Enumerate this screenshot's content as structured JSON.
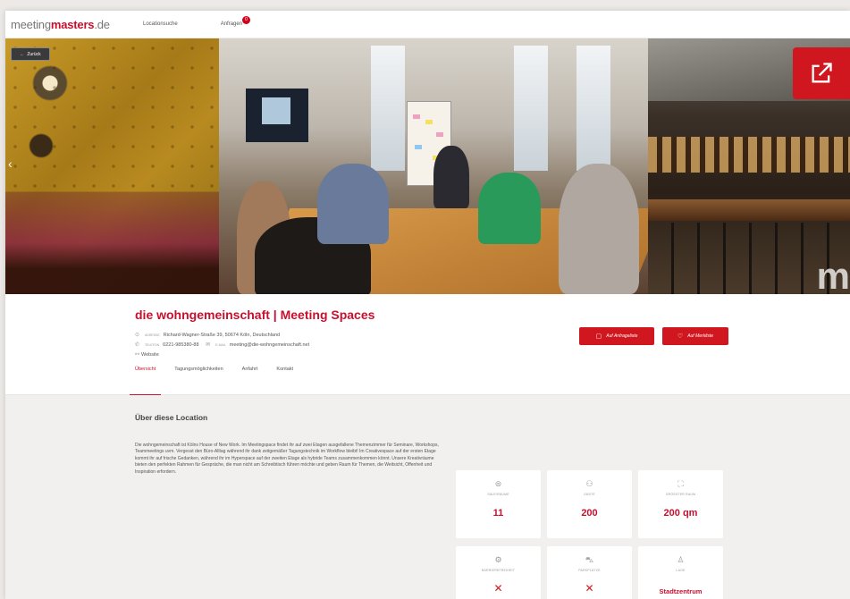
{
  "nav": {
    "logo_prefix": "meeting",
    "logo_brand": "masters",
    "logo_tld": ".de",
    "links": [
      "Locationsuche",
      "Anfragen"
    ],
    "requests_count": "0"
  },
  "hero": {
    "back_label": "Zurück",
    "watermark": "m"
  },
  "venue": {
    "title": "die wohngemeinschaft | Meeting Spaces",
    "address_label": "Adresse",
    "address": "Richard-Wagner-Straße 39, 50674 Köln, Deutschland",
    "phone_label": "Telefon",
    "phone": "0221-985380-88",
    "email_label": "E-Mail",
    "email": "meeting@die-wohngemeinschaft.net",
    "website": "Website",
    "btn_request": "Auf Anfrageliste",
    "btn_watch": "Auf Merkliste"
  },
  "tabs": [
    "Übersicht",
    "Tagungsmöglichkeiten",
    "Anfahrt",
    "Kontakt"
  ],
  "about": {
    "heading": "Über diese Location",
    "text": "Die wohngemeinschaft ist Kölns House of New Work. Im Meetingspace findet ihr auf zwei Etagen ausgefallene Themenzimmer für Seminare, Workshops, Teammeetings uvm. Vergesst den Büro-Alltag während ihr dank zeitgemäßer Tagungstechnik im Workflow bleibt! Im Creativespace auf der ersten Etage kommt ihr auf frische Gedanken, während ihr im Hyperspace auf der zweiten Etage als hybride Teams zusammenkommen könnt. Unsere Kreativräume bieten den perfekten Rahmen für Gespräche, die man nicht am Schreibtisch führen möchte und geben Raum für Themen, die Weitsicht, Offenheit und Inspiration erfordern."
  },
  "facts": [
    {
      "label": "Säle/Räume",
      "value": "11",
      "icon": "rooms-icon",
      "glyph": "⊜"
    },
    {
      "label": "Gäste",
      "value": "200",
      "icon": "guests-icon",
      "glyph": "⚇"
    },
    {
      "label": "Größter Raum",
      "value": "200 qm",
      "icon": "area-icon",
      "glyph": "⛶"
    },
    {
      "label": "Barrierefreiheit",
      "value": "✕",
      "icon": "accessibility-icon",
      "glyph": "⚙"
    },
    {
      "label": "Parkplätze",
      "value": "✕",
      "icon": "parking-icon",
      "glyph": "⛍"
    },
    {
      "label": "Lage",
      "value": "Stadtzentrum",
      "icon": "location-icon",
      "glyph": "♙"
    }
  ]
}
